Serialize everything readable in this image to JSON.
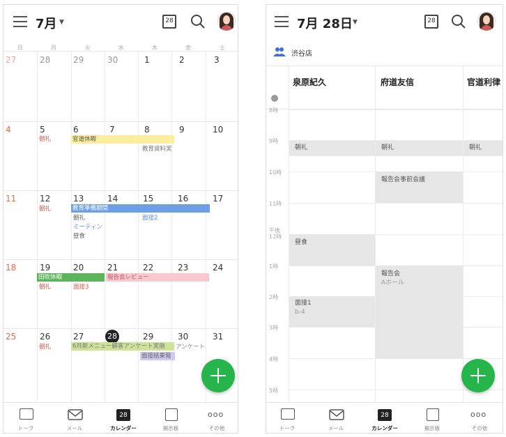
{
  "month_view": {
    "title": "7月",
    "calendar_icon_day": "28",
    "weekdays": [
      "日",
      "月",
      "火",
      "水",
      "木",
      "金",
      "土"
    ],
    "weeks": [
      [
        "27",
        "28",
        "29",
        "30",
        "1",
        "2",
        "3"
      ],
      [
        "4",
        "5",
        "6",
        "7",
        "8",
        "9",
        "10"
      ],
      [
        "11",
        "12",
        "13",
        "14",
        "15",
        "16",
        "17"
      ],
      [
        "18",
        "19",
        "20",
        "21",
        "22",
        "23",
        "24"
      ],
      [
        "25",
        "26",
        "27",
        "28",
        "29",
        "30",
        "31"
      ]
    ],
    "events": {
      "w2_mon_chorei": "朝礼",
      "w2_tue_holiday": "官道休暇",
      "w2_thu_kyoiku": "教育資料実",
      "w3_bar_kyoiku": "教育準備期間",
      "w3_mon_chorei": "朝礼",
      "w3_tue_chorei": "朝礼",
      "w3_tue_meeting": "ミーティン",
      "w3_tue_lunch": "昼食",
      "w3_thu_interview": "面接2",
      "w4_bar_holiday": "田吹休暇",
      "w4_bar_review": "報告会レビュー",
      "w4_mon_chorei": "朝礼",
      "w4_tue_interview": "面接3",
      "w5_mon_chorei": "朝礼",
      "w5_bar_menu": "6月新メニュー顧客アンケート実施",
      "w5_sat_survey": "アンケート",
      "w5_thu_result": "面接結果発"
    }
  },
  "day_view": {
    "title": "7月 28日",
    "calendar_icon_day": "28",
    "group": "渋谷店",
    "people": [
      "泉原紀久",
      "府道友信",
      "官道利律"
    ],
    "hours": [
      "8時",
      "9時",
      "10時",
      "11時",
      "午後",
      "12時",
      "1時",
      "2時",
      "3時",
      "4時",
      "5時"
    ],
    "events": {
      "p1_chorei": "朝礼",
      "p2_chorei": "朝礼",
      "p3_chorei": "朝礼",
      "p2_pre_meeting": "報告会事前会議",
      "p1_lunch": "昼食",
      "p2_report": "報告会",
      "p2_report_loc": "Aホール",
      "p1_interview": "面接1",
      "p1_interview_loc": "b-4"
    }
  },
  "tabbar": {
    "items": [
      "トーク",
      "メール",
      "カレンダー",
      "掲示板",
      "その他"
    ],
    "calendar_day": "28"
  },
  "colors": {
    "sunday": "#e8694a",
    "today": "#222222",
    "accent_green": "#26b54a",
    "bar_yellow": "#fbee9c",
    "bar_blue": "#6e9ee3",
    "bar_green": "#5cb55c",
    "bar_pink": "#f7c9cf",
    "bar_olive": "#cfe29a",
    "bar_lavender": "#cfc8ef",
    "event_red": "#e05a4a",
    "event_blue": "#5e8ee0"
  }
}
